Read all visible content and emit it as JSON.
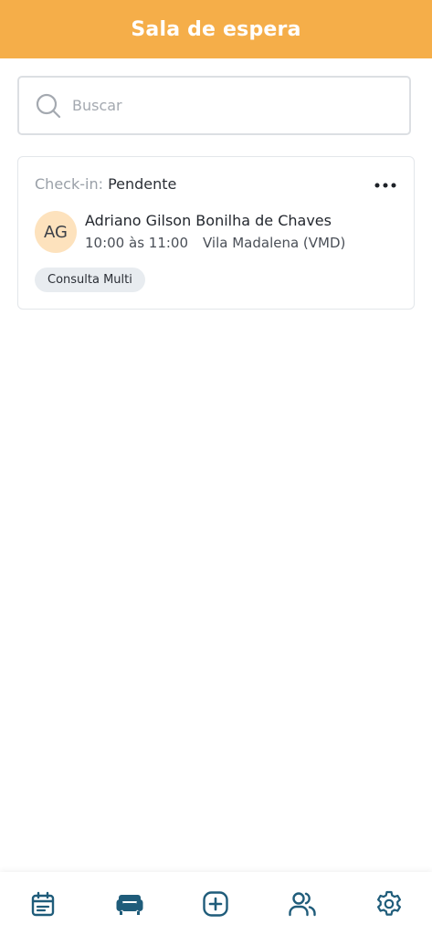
{
  "header": {
    "title": "Sala de espera"
  },
  "search": {
    "placeholder": "Buscar"
  },
  "appointment": {
    "checkin_label": "Check-in:",
    "checkin_status": "Pendente",
    "avatar_initials": "AG",
    "patient_name": "Adriano Gilson Bonilha de Chaves",
    "time": "10:00 às 11:00",
    "location": "Vila Madalena (VMD)",
    "tag": "Consulta Multi"
  },
  "nav": {
    "items": [
      {
        "icon": "calendar-icon"
      },
      {
        "icon": "armchair-icon",
        "active": true
      },
      {
        "icon": "plus-square-icon"
      },
      {
        "icon": "users-icon"
      },
      {
        "icon": "gear-icon"
      }
    ]
  },
  "colors": {
    "header": "#f5ae49",
    "nav_icon": "#1f5c7a",
    "avatar_bg": "#fde2bd"
  }
}
